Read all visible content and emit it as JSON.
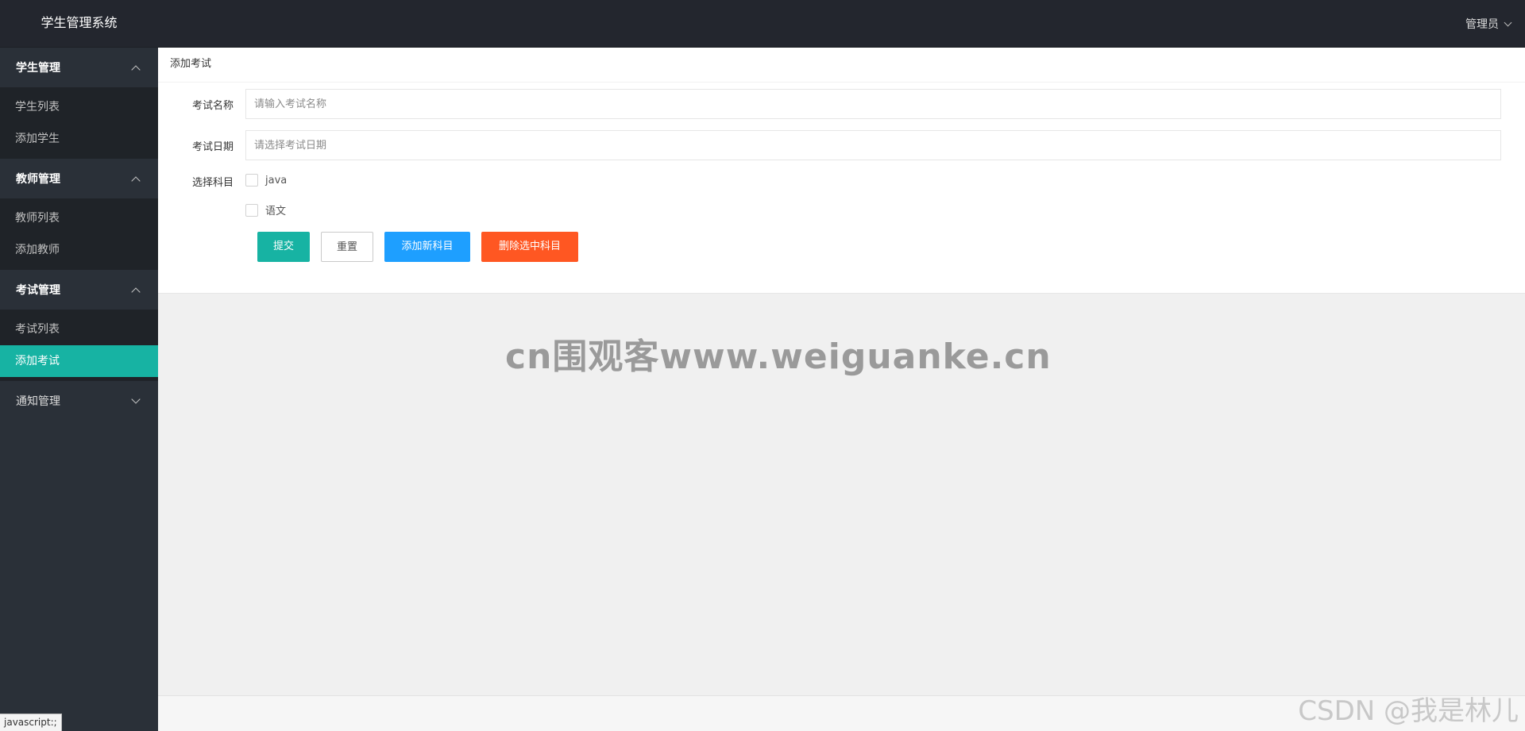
{
  "app": {
    "title": "学生管理系统"
  },
  "header": {
    "user_label": "管理员"
  },
  "sidebar": {
    "groups": [
      {
        "label": "学生管理",
        "expanded": true,
        "items": [
          {
            "label": "学生列表"
          },
          {
            "label": "添加学生"
          }
        ]
      },
      {
        "label": "教师管理",
        "expanded": true,
        "items": [
          {
            "label": "教师列表"
          },
          {
            "label": "添加教师"
          }
        ]
      },
      {
        "label": "考试管理",
        "expanded": true,
        "items": [
          {
            "label": "考试列表"
          },
          {
            "label": "添加考试",
            "active": true
          }
        ]
      },
      {
        "label": "通知管理",
        "expanded": false,
        "items": []
      }
    ]
  },
  "main": {
    "breadcrumb": "添加考试",
    "form": {
      "exam_name": {
        "label": "考试名称",
        "value": "",
        "placeholder": "请输入考试名称"
      },
      "exam_date": {
        "label": "考试日期",
        "value": "",
        "placeholder": "请选择考试日期"
      },
      "subjects": {
        "label": "选择科目",
        "options": [
          {
            "label": "java",
            "checked": false
          },
          {
            "label": "语文",
            "checked": false
          }
        ]
      },
      "buttons": {
        "submit": "提交",
        "reset": "重置",
        "add_subject": "添加新科目",
        "delete_subject": "删除选中科目"
      }
    }
  },
  "overlays": {
    "watermark": "cn围观客www.weiguanke.cn",
    "csdn_watermark": "CSDN @我是林儿",
    "status_tip": "javascript:;"
  },
  "colors": {
    "sidebar_bg": "#2a3038",
    "header_bg": "#23262e",
    "accent": "#17b3a3",
    "add_button": "#1e9fff",
    "delete_button": "#ff5722"
  }
}
